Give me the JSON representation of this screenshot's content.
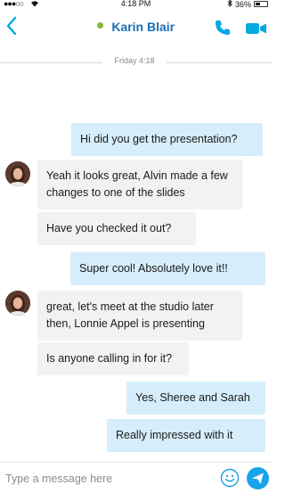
{
  "status_bar": {
    "signal": "●●●○○",
    "time": "4:18 PM",
    "battery": "36%"
  },
  "header": {
    "title": "Karin Blair"
  },
  "conversation": {
    "date_separator": "Friday 4:18",
    "messages": [
      {
        "direction": "outgoing",
        "text": "Hi did you get the presentation?"
      },
      {
        "direction": "incoming",
        "text": "Yeah it looks great, Alvin made a few changes to one of the slides"
      },
      {
        "direction": "incoming",
        "text": "Have you checked it out?"
      },
      {
        "direction": "outgoing",
        "text": "Super cool! Absolutely love it!!"
      },
      {
        "direction": "incoming",
        "text": "great, let's meet at the studio later then, Lonnie Appel is presenting"
      },
      {
        "direction": "incoming",
        "text": "Is anyone calling in for it?"
      },
      {
        "direction": "outgoing",
        "text": "Yes, Sheree and Sarah"
      },
      {
        "direction": "outgoing",
        "text": "Really impressed with it"
      }
    ]
  },
  "composer": {
    "placeholder": "Type a message here"
  },
  "colors": {
    "accent": "#00a9e0",
    "title": "#1a6fb4",
    "online": "#7dbb3a",
    "outgoing_bubble": "#d6eefb",
    "incoming_bubble": "#f0f2f4",
    "send": "#16a4ea"
  },
  "icons": [
    "back-chevron-icon",
    "online-status-icon",
    "phone-icon",
    "video-camera-icon",
    "emoji-icon",
    "send-icon",
    "battery-icon",
    "bluetooth-icon",
    "wifi-icon"
  ]
}
